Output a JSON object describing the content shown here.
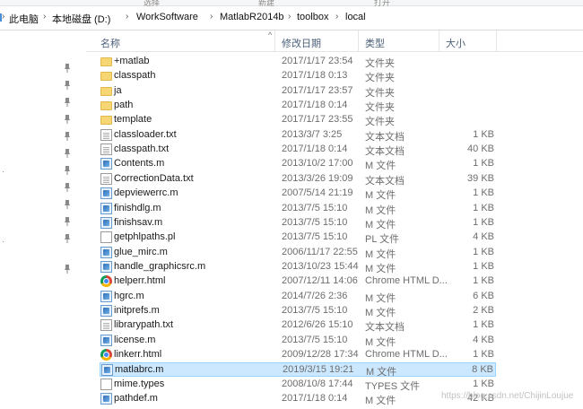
{
  "ribbon": {
    "labels": [
      "选择",
      "新建",
      "打开"
    ]
  },
  "address": {
    "crumbs": [
      "此电脑",
      "本地磁盘 (D:)",
      "WorkSoftware",
      "MatlabR2014b",
      "toolbox",
      "local"
    ],
    "separator": "›"
  },
  "columns": {
    "name": "名称",
    "date": "修改日期",
    "type": "类型",
    "size": "大小"
  },
  "sort_indicator": "^",
  "files": [
    {
      "name": "+matlab",
      "date": "2017/1/17 23:54",
      "type": "文件夹",
      "size": "",
      "icon": "folder-icon"
    },
    {
      "name": "classpath",
      "date": "2017/1/18 0:13",
      "type": "文件夹",
      "size": "",
      "icon": "folder-icon"
    },
    {
      "name": "ja",
      "date": "2017/1/17 23:57",
      "type": "文件夹",
      "size": "",
      "icon": "folder-icon"
    },
    {
      "name": "path",
      "date": "2017/1/18 0:14",
      "type": "文件夹",
      "size": "",
      "icon": "folder-icon"
    },
    {
      "name": "template",
      "date": "2017/1/17 23:55",
      "type": "文件夹",
      "size": "",
      "icon": "folder-icon"
    },
    {
      "name": "classloader.txt",
      "date": "2013/3/7 3:25",
      "type": "文本文档",
      "size": "1 KB",
      "icon": "text-file-icon"
    },
    {
      "name": "classpath.txt",
      "date": "2017/1/18 0:14",
      "type": "文本文档",
      "size": "40 KB",
      "icon": "text-file-icon"
    },
    {
      "name": "Contents.m",
      "date": "2013/10/2 17:00",
      "type": "M 文件",
      "size": "1 KB",
      "icon": "matlab-file-icon"
    },
    {
      "name": "CorrectionData.txt",
      "date": "2013/3/26 19:09",
      "type": "文本文档",
      "size": "39 KB",
      "icon": "text-file-icon"
    },
    {
      "name": "depviewerrc.m",
      "date": "2007/5/14 21:19",
      "type": "M 文件",
      "size": "1 KB",
      "icon": "matlab-file-icon"
    },
    {
      "name": "finishdlg.m",
      "date": "2013/7/5 15:10",
      "type": "M 文件",
      "size": "1 KB",
      "icon": "matlab-file-icon"
    },
    {
      "name": "finishsav.m",
      "date": "2013/7/5 15:10",
      "type": "M 文件",
      "size": "1 KB",
      "icon": "matlab-file-icon"
    },
    {
      "name": "getphlpaths.pl",
      "date": "2013/7/5 15:10",
      "type": "PL 文件",
      "size": "4 KB",
      "icon": "pl-file-icon"
    },
    {
      "name": "glue_mirc.m",
      "date": "2006/11/17 22:55",
      "type": "M 文件",
      "size": "1 KB",
      "icon": "matlab-file-icon"
    },
    {
      "name": "handle_graphicsrc.m",
      "date": "2013/10/23 15:44",
      "type": "M 文件",
      "size": "1 KB",
      "icon": "matlab-file-icon"
    },
    {
      "name": "helperr.html",
      "date": "2007/12/11 14:06",
      "type": "Chrome HTML D...",
      "size": "1 KB",
      "icon": "chrome-html-icon"
    },
    {
      "name": "hgrc.m",
      "date": "2014/7/26 2:36",
      "type": "M 文件",
      "size": "6 KB",
      "icon": "matlab-file-icon"
    },
    {
      "name": "initprefs.m",
      "date": "2013/7/5 15:10",
      "type": "M 文件",
      "size": "2 KB",
      "icon": "matlab-file-icon"
    },
    {
      "name": "librarypath.txt",
      "date": "2012/6/26 15:10",
      "type": "文本文档",
      "size": "1 KB",
      "icon": "text-file-icon"
    },
    {
      "name": "license.m",
      "date": "2013/7/5 15:10",
      "type": "M 文件",
      "size": "4 KB",
      "icon": "matlab-file-icon"
    },
    {
      "name": "linkerr.html",
      "date": "2009/12/28 17:34",
      "type": "Chrome HTML D...",
      "size": "1 KB",
      "icon": "chrome-html-icon"
    },
    {
      "name": "matlabrc.m",
      "date": "2019/3/15 19:21",
      "type": "M 文件",
      "size": "8 KB",
      "icon": "matlab-file-icon",
      "selected": true
    },
    {
      "name": "mime.types",
      "date": "2008/10/8 17:44",
      "type": "TYPES 文件",
      "size": "1 KB",
      "icon": "blank-file-icon"
    },
    {
      "name": "pathdef.m",
      "date": "2017/1/18 0:14",
      "type": "M 文件",
      "size": "42 KB",
      "icon": "matlab-file-icon"
    }
  ],
  "watermark": "https://blog.csdn.net/ChijinLoujue",
  "colors": {
    "selection": "#cce8ff",
    "selection_border": "#99d1ff",
    "header_text": "#4c607a",
    "folder": "#f7d774"
  }
}
